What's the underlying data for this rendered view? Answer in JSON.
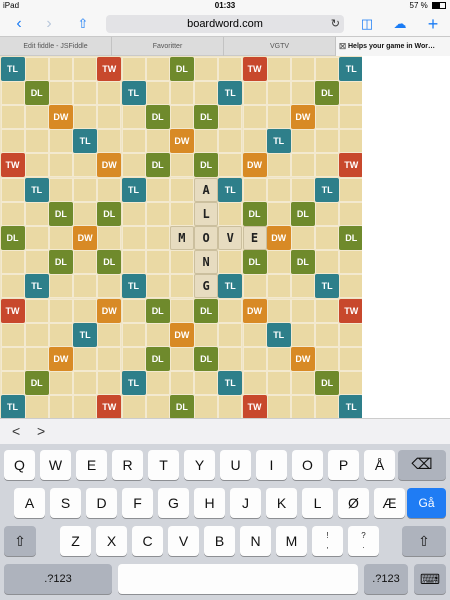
{
  "status": {
    "device": "iPad",
    "time": "01:33",
    "battery": "57 %"
  },
  "nav": {
    "url": "boardword.com"
  },
  "tabs": [
    {
      "label": "Edit fiddle - JSFiddle"
    },
    {
      "label": "Favoritter"
    },
    {
      "label": "VGTV"
    },
    {
      "label": "Helps your game in Wor…"
    }
  ],
  "board": {
    "premiums": [
      [
        "TL",
        "",
        "",
        "",
        "TW",
        "",
        "",
        "DL",
        "",
        "",
        "TW",
        "",
        "",
        "",
        "TL"
      ],
      [
        "",
        "DL",
        "",
        "",
        "",
        "TL",
        "",
        "",
        "",
        "TL",
        "",
        "",
        "",
        "DL",
        ""
      ],
      [
        "",
        "",
        "DW",
        "",
        "",
        "",
        "DL",
        "",
        "DL",
        "",
        "",
        "",
        "DW",
        "",
        ""
      ],
      [
        "",
        "",
        "",
        "TL",
        "",
        "",
        "",
        "DW",
        "",
        "",
        "",
        "TL",
        "",
        "",
        ""
      ],
      [
        "TW",
        "",
        "",
        "",
        "DW",
        "",
        "DL",
        "",
        "DL",
        "",
        "DW",
        "",
        "",
        "",
        "TW"
      ],
      [
        "",
        "TL",
        "",
        "",
        "",
        "TL",
        "",
        "",
        "",
        "TL",
        "",
        "",
        "",
        "TL",
        ""
      ],
      [
        "",
        "",
        "DL",
        "",
        "DL",
        "",
        "",
        "",
        "",
        "",
        "DL",
        "",
        "DL",
        "",
        ""
      ],
      [
        "DL",
        "",
        "",
        "DW",
        "",
        "",
        "",
        "",
        "",
        "",
        "",
        "DW",
        "",
        "",
        "DL"
      ],
      [
        "",
        "",
        "DL",
        "",
        "DL",
        "",
        "",
        "",
        "",
        "",
        "DL",
        "",
        "DL",
        "",
        ""
      ],
      [
        "",
        "TL",
        "",
        "",
        "",
        "TL",
        "",
        "",
        "",
        "TL",
        "",
        "",
        "",
        "TL",
        ""
      ],
      [
        "TW",
        "",
        "",
        "",
        "DW",
        "",
        "DL",
        "",
        "DL",
        "",
        "DW",
        "",
        "",
        "",
        "TW"
      ],
      [
        "",
        "",
        "",
        "TL",
        "",
        "",
        "",
        "DW",
        "",
        "",
        "",
        "TL",
        "",
        "",
        ""
      ],
      [
        "",
        "",
        "DW",
        "",
        "",
        "",
        "DL",
        "",
        "DL",
        "",
        "",
        "",
        "DW",
        "",
        ""
      ],
      [
        "",
        "DL",
        "",
        "",
        "",
        "TL",
        "",
        "",
        "",
        "TL",
        "",
        "",
        "",
        "DL",
        ""
      ],
      [
        "TL",
        "",
        "",
        "",
        "TW",
        "",
        "",
        "DL",
        "",
        "",
        "TW",
        "",
        "",
        "",
        "TL"
      ]
    ],
    "tiles": [
      {
        "row": 5,
        "col": 8,
        "letter": "A"
      },
      {
        "row": 6,
        "col": 8,
        "letter": "L"
      },
      {
        "row": 7,
        "col": 7,
        "letter": "M"
      },
      {
        "row": 7,
        "col": 8,
        "letter": "O"
      },
      {
        "row": 7,
        "col": 9,
        "letter": "V"
      },
      {
        "row": 7,
        "col": 10,
        "letter": "E"
      },
      {
        "row": 8,
        "col": 8,
        "letter": "N"
      },
      {
        "row": 9,
        "col": 8,
        "letter": "G"
      }
    ]
  },
  "formbar": {
    "prev": "<",
    "next": ">"
  },
  "keyboard": {
    "row1": [
      "Q",
      "W",
      "E",
      "R",
      "T",
      "Y",
      "U",
      "I",
      "O",
      "P",
      "Å"
    ],
    "row2": [
      "A",
      "S",
      "D",
      "F",
      "G",
      "H",
      "J",
      "K",
      "L",
      "Ø",
      "Æ"
    ],
    "row3": [
      "Z",
      "X",
      "C",
      "V",
      "B",
      "N",
      "M",
      "!",
      ",",
      "?",
      "."
    ],
    "go": "Gå",
    "numkey": ".?123"
  }
}
